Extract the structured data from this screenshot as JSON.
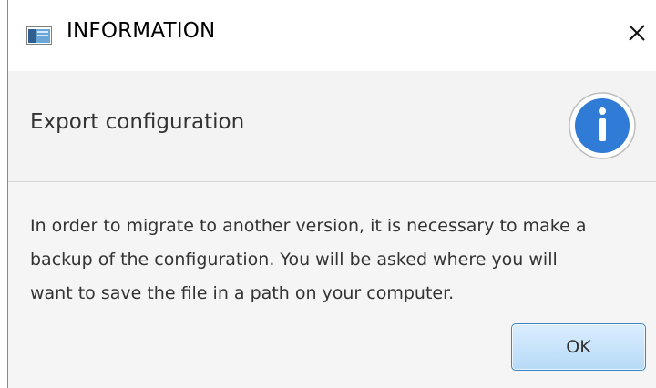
{
  "dialog": {
    "title": "INFORMATION",
    "header_text": "Export configuration",
    "message": "In order to migrate to another version, it is necessary to make a\nbackup of the configuration. You will be asked where you will\nwant to save the file in a path on your computer.",
    "ok_label": "OK",
    "icons": {
      "app": "app-window-icon",
      "close": "close-icon",
      "info": "info-icon"
    },
    "colors": {
      "info_blue": "#2f7bd6",
      "button_border": "#3d86c4",
      "button_fill": "#c8e4fb",
      "header_bg": "#f3f3f3",
      "content_bg": "#f5f5f5"
    }
  }
}
